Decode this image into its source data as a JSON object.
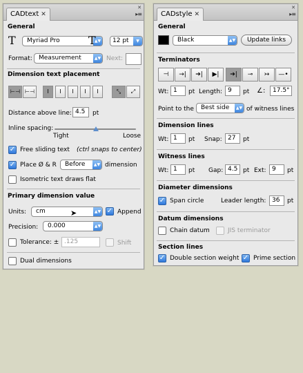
{
  "colors": {
    "swatch": "#000000",
    "accent": "#3f86df"
  },
  "cadtext": {
    "tab_label": "CADtext",
    "general": {
      "heading": "General",
      "font_icon": "T",
      "font_name": "Myriad Pro",
      "size_icon": "T",
      "size_value": "12 pt",
      "format_label": "Format:",
      "format_value": "Measurement",
      "next_label": "Next:"
    },
    "placement": {
      "heading": "Dimension text placement",
      "distance_label": "Distance above line:",
      "distance_value": "4.5",
      "distance_unit": "pt",
      "inline_label": "Inline spacing:",
      "tight_label": "Tight",
      "loose_label": "Loose",
      "inline_spacing_fraction": 0.42,
      "free_sliding_label": "Free sliding text",
      "free_sliding_note": "(ctrl snaps to center)",
      "place_label": "Place Ø & R",
      "place_value": "Before",
      "place_suffix": "dimension",
      "iso_label": "Isometric text draws flat"
    },
    "primary": {
      "heading": "Primary dimension value",
      "units_label": "Units:",
      "units_value": "cm",
      "append_label": "Append",
      "precision_label": "Precision:",
      "precision_value": "0.000",
      "tolerance_label": "Tolerance: ±",
      "tolerance_value": ".125",
      "shift_label": "Shift"
    },
    "dual_label": "Dual dimensions"
  },
  "cadstyle": {
    "tab_label": "CADstyle",
    "general": {
      "heading": "General",
      "color_value": "Black",
      "update_label": "Update links"
    },
    "terminators": {
      "heading": "Terminators",
      "wt_label": "Wt:",
      "wt_value": "1",
      "wt_unit": "pt",
      "length_label": "Length:",
      "length_value": "9",
      "length_unit": "pt",
      "angle_icon": "∠:",
      "angle_value": "17.5°",
      "point_label": "Point to the",
      "point_value": "Best side",
      "point_suffix": "of witness lines"
    },
    "dimension_lines": {
      "heading": "Dimension lines",
      "wt_label": "Wt:",
      "wt_value": "1",
      "wt_unit": "pt",
      "snap_label": "Snap:",
      "snap_value": "27",
      "snap_unit": "pt"
    },
    "witness_lines": {
      "heading": "Witness lines",
      "wt_label": "Wt:",
      "wt_value": "1",
      "wt_unit": "pt",
      "gap_label": "Gap:",
      "gap_value": "4.5",
      "gap_unit": "pt",
      "ext_label": "Ext:",
      "ext_value": "9",
      "ext_unit": "pt"
    },
    "diameter": {
      "heading": "Diameter dimensions",
      "span_label": "Span circle",
      "leader_label": "Leader length:",
      "leader_value": "36",
      "leader_unit": "pt"
    },
    "datum": {
      "heading": "Datum dimensions",
      "chain_label": "Chain datum",
      "jis_label": "JIS terminator"
    },
    "section": {
      "heading": "Section lines",
      "double_label": "Double section weight",
      "prime_label": "Prime section"
    }
  }
}
